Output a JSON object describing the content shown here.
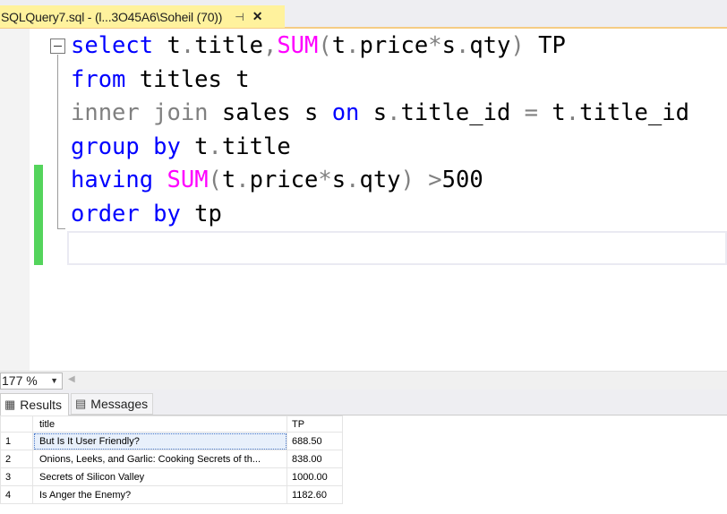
{
  "tab": {
    "title": "SQLQuery7.sql - (l...3O45A6\\Soheil (70))",
    "pin_glyph": "⊣",
    "close_glyph": "✕"
  },
  "editor": {
    "lines": [
      [
        {
          "t": "select",
          "c": "kw"
        },
        {
          "t": " t",
          "c": ""
        },
        {
          "t": ".",
          "c": "gr"
        },
        {
          "t": "title",
          "c": ""
        },
        {
          "t": ",",
          "c": "gr"
        },
        {
          "t": "SUM",
          "c": "fn"
        },
        {
          "t": "(",
          "c": "gr"
        },
        {
          "t": "t",
          "c": ""
        },
        {
          "t": ".",
          "c": "gr"
        },
        {
          "t": "price",
          "c": ""
        },
        {
          "t": "*",
          "c": "gr"
        },
        {
          "t": "s",
          "c": ""
        },
        {
          "t": ".",
          "c": "gr"
        },
        {
          "t": "qty",
          "c": ""
        },
        {
          "t": ")",
          "c": "gr"
        },
        {
          "t": " TP",
          "c": ""
        }
      ],
      [
        {
          "t": "from",
          "c": "kw"
        },
        {
          "t": " titles t",
          "c": ""
        }
      ],
      [
        {
          "t": "inner join",
          "c": "gr"
        },
        {
          "t": " sales s ",
          "c": ""
        },
        {
          "t": "on",
          "c": "kw"
        },
        {
          "t": " s",
          "c": ""
        },
        {
          "t": ".",
          "c": "gr"
        },
        {
          "t": "title_id ",
          "c": ""
        },
        {
          "t": "=",
          "c": "gr"
        },
        {
          "t": " t",
          "c": ""
        },
        {
          "t": ".",
          "c": "gr"
        },
        {
          "t": "title_id",
          "c": ""
        }
      ],
      [
        {
          "t": "group by",
          "c": "kw"
        },
        {
          "t": " t",
          "c": ""
        },
        {
          "t": ".",
          "c": "gr"
        },
        {
          "t": "title",
          "c": ""
        }
      ],
      [
        {
          "t": "having",
          "c": "kw"
        },
        {
          "t": " ",
          "c": ""
        },
        {
          "t": "SUM",
          "c": "fn"
        },
        {
          "t": "(",
          "c": "gr"
        },
        {
          "t": "t",
          "c": ""
        },
        {
          "t": ".",
          "c": "gr"
        },
        {
          "t": "price",
          "c": ""
        },
        {
          "t": "*",
          "c": "gr"
        },
        {
          "t": "s",
          "c": ""
        },
        {
          "t": ".",
          "c": "gr"
        },
        {
          "t": "qty",
          "c": ""
        },
        {
          "t": ")",
          "c": "gr"
        },
        {
          "t": " ",
          "c": ""
        },
        {
          "t": ">",
          "c": "gr"
        },
        {
          "t": "500",
          "c": ""
        }
      ],
      [
        {
          "t": "order by",
          "c": "kw"
        },
        {
          "t": " tp",
          "c": ""
        }
      ]
    ],
    "colors": {
      "keyword": "#0000ff",
      "function": "#ff00ff",
      "operator": "#808080",
      "change_bar": "#54d45c"
    }
  },
  "zoom": {
    "value": "177 %"
  },
  "results_tabs": [
    {
      "label": "Results",
      "icon": "grid-icon"
    },
    {
      "label": "Messages",
      "icon": "messages-icon"
    }
  ],
  "grid": {
    "columns": [
      "title",
      "TP"
    ],
    "rows": [
      {
        "num": "1",
        "title": "But Is It User Friendly?",
        "tp": "688.50"
      },
      {
        "num": "2",
        "title": "Onions, Leeks, and Garlic: Cooking Secrets of th...",
        "tp": "838.00"
      },
      {
        "num": "3",
        "title": "Secrets of Silicon Valley",
        "tp": "1000.00"
      },
      {
        "num": "4",
        "title": "Is Anger the Enemy?",
        "tp": "1182.60"
      }
    ]
  }
}
